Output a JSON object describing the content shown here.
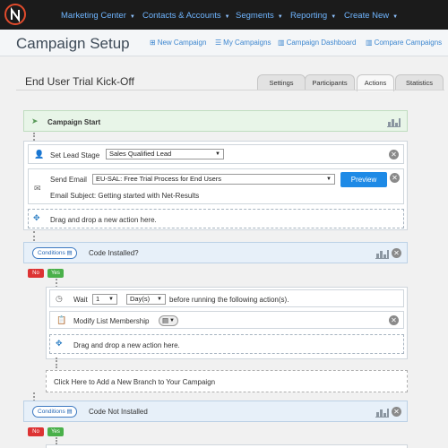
{
  "nav": {
    "items": [
      {
        "label": "Marketing Center"
      },
      {
        "label": "Contacts & Accounts"
      },
      {
        "label": "Segments"
      },
      {
        "label": "Reporting"
      },
      {
        "label": "Create New"
      }
    ],
    "caret": "▼",
    "accent": "#6fb5ff"
  },
  "header": {
    "title": "Campaign Setup",
    "links": [
      {
        "label": "New Campaign",
        "icon": "plus-icon"
      },
      {
        "label": "My Campaigns",
        "icon": "list-icon"
      },
      {
        "label": "Campaign Dashboard",
        "icon": "bar-chart-icon"
      },
      {
        "label": "Compare Campaigns",
        "icon": "bar-chart-icon"
      }
    ]
  },
  "campaign": {
    "name": "End User Trial Kick-Off",
    "tabs": [
      {
        "label": "Settings"
      },
      {
        "label": "Participants"
      },
      {
        "label": "Actions",
        "active": true
      },
      {
        "label": "Statistics"
      }
    ]
  },
  "start": {
    "label": "Campaign Start"
  },
  "actions": {
    "lead_stage": {
      "label": "Set Lead Stage",
      "value": "Sales Qualified Lead"
    },
    "send_email": {
      "label": "Send Email",
      "value": "EU-SAL: Free Trial Process for End Users",
      "preview": "Preview",
      "subject": "Email Subject: Getting started with Net-Results"
    },
    "drop1": "Drag and drop a new action here."
  },
  "condition1": {
    "button": "Conditions",
    "text": "Code Installed?",
    "no": "No",
    "yes": "Yes",
    "wait": {
      "label": "Wait",
      "amount": "1",
      "unit": "Day(s)",
      "suffix": "before running the following action(s)."
    },
    "modify": {
      "label": "Modify List Membership"
    },
    "drop": "Drag and drop a new action here."
  },
  "branch": {
    "label": "Click Here to Add a New Branch to Your Campaign"
  },
  "condition2": {
    "button": "Conditions",
    "text": "Code Not Installed",
    "no": "No",
    "yes": "Yes"
  }
}
